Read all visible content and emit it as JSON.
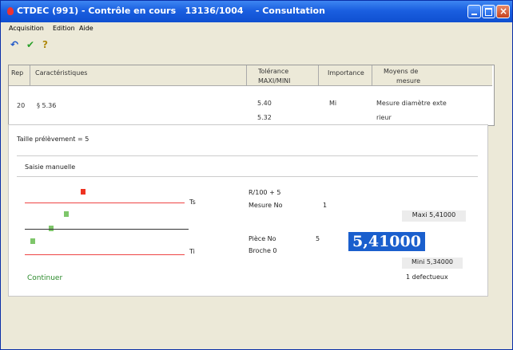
{
  "window": {
    "title": "CTDEC (991) - Contrôle en cours   13136/1004    - Consultation"
  },
  "menu": [
    "Acquisition",
    "Edition",
    "Aide"
  ],
  "toolbar": {
    "undo": "↶",
    "check": "✔",
    "help": "?"
  },
  "table": {
    "headers": {
      "rep": "Rep",
      "carac": "Caractéristiques",
      "tol_1": "Tolérance",
      "tol_2": "MAXI/MINI",
      "importance": "Importance",
      "moyens_1": "Moyens de",
      "moyens_2": "mesure"
    },
    "row": {
      "rep": "20",
      "carac": "§ 5.36",
      "tol_max": "5.40",
      "tol_min": "5.32",
      "importance": "Mi",
      "moyens_1": "Mesure diamètre exte",
      "moyens_2": "rieur"
    }
  },
  "taille": "Taille prélèvement = 5",
  "saisie": "Saisie manuelle",
  "gauge": {
    "ts": "Ts",
    "ti": "Ti"
  },
  "info": {
    "formula": "R/100 + 5",
    "mesure_label": "Mesure No",
    "mesure_value": "1",
    "piece_label": "Pièce No",
    "piece_value": "5",
    "broche": "Broche 0"
  },
  "values": {
    "maxi": "Maxi 5,41000",
    "current": "5,41000",
    "mini": "Mini 5,34000",
    "defectueux": "1 defectueux"
  },
  "continuer": "Continuer",
  "colors": {
    "red": "#e44",
    "green": "#7ec66a",
    "accent": "#1a5fcd"
  }
}
